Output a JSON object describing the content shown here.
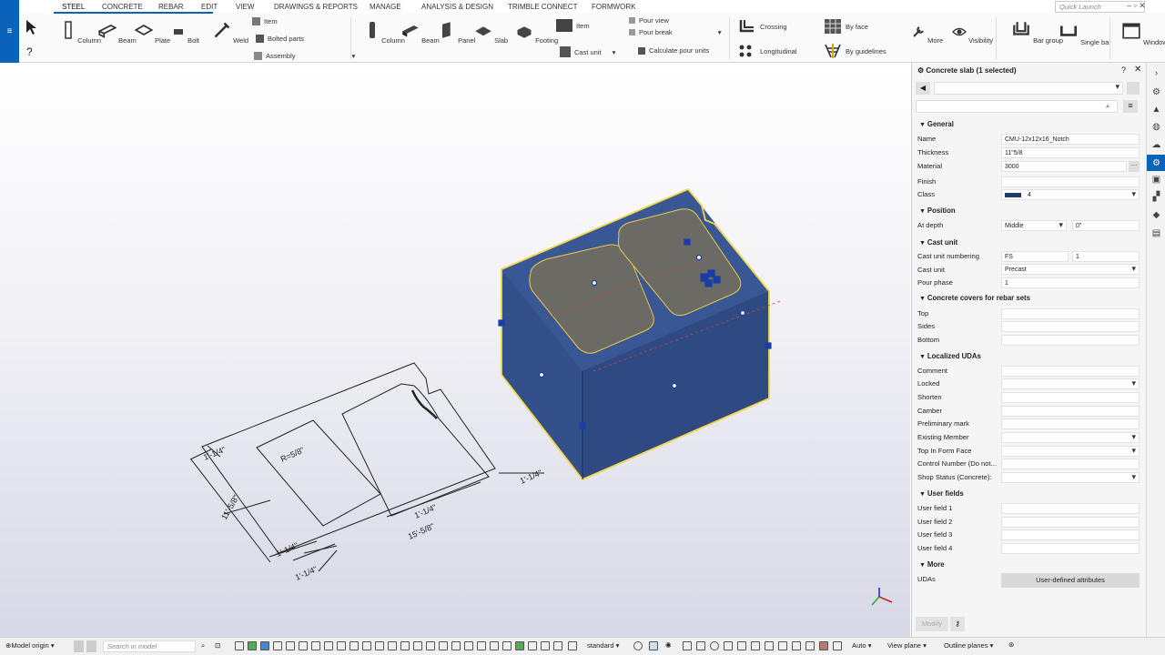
{
  "app": {
    "quick_launch_placeholder": "Quick Launch"
  },
  "menu_tabs": [
    "STEEL",
    "CONCRETE",
    "REBAR",
    "EDIT",
    "VIEW",
    "DRAWINGS & REPORTS",
    "MANAGE",
    "ANALYSIS & DESIGN",
    "TRIMBLE CONNECT",
    "FORMWORK"
  ],
  "ribbon": {
    "steel": {
      "column": "Column",
      "beam": "Beam",
      "plate": "Plate",
      "bolt": "Bolt",
      "weld": "Weld",
      "item": "Item",
      "bolted_parts": "Bolted parts",
      "assembly": "Assembly"
    },
    "concrete": {
      "column": "Column",
      "beam": "Beam",
      "panel": "Panel",
      "slab": "Slab",
      "footing": "Footing",
      "item": "Item",
      "cast_unit": "Cast unit",
      "pour_view": "Pour view",
      "pour_break": "Pour break",
      "calculate_pour_units": "Calculate pour units"
    },
    "rebar": {
      "crossing": "Crossing",
      "longitudinal": "Longitudinal",
      "by_face": "By face",
      "by_guidelines": "By guidelines",
      "more": "More",
      "visibility": "Visibility",
      "bar_group": "Bar group",
      "single_bar": "Single bar",
      "window": "Window"
    }
  },
  "drawing": {
    "dims": [
      "1'-1/4\"",
      "11'-5/8\"",
      "R=5/8\"",
      "1'-1/4\"",
      "1'-1/4\"",
      "1'-1/4\"",
      "15'-5/8\"",
      "1'-1/4\""
    ]
  },
  "panel": {
    "title": "Concrete slab (1 selected)",
    "sections": {
      "general": "General",
      "position": "Position",
      "cast_unit": "Cast unit",
      "covers": "Concrete covers for rebar sets",
      "udas": "Localized UDAs",
      "user_fields": "User fields",
      "more": "More"
    },
    "labels": {
      "name": "Name",
      "thickness": "Thickness",
      "material": "Material",
      "finish": "Finish",
      "class": "Class",
      "at_depth": "At depth",
      "cast_unit_numbering": "Cast unit numbering",
      "cast_unit": "Cast unit",
      "pour_phase": "Pour phase",
      "top": "Top",
      "sides": "Sides",
      "bottom": "Bottom",
      "comment": "Comment",
      "locked": "Locked",
      "shorten": "Shorten",
      "camber": "Camber",
      "preliminary_mark": "Preliminary mark",
      "existing_member": "Existing Member",
      "top_in_form_face": "Top In Form Face",
      "control_number": "Control Number (Do not...",
      "shop_status": "Shop Status (Concrete):",
      "uf1": "User field 1",
      "uf2": "User field 2",
      "uf3": "User field 3",
      "uf4": "User field 4",
      "udas": "UDAs"
    },
    "values": {
      "name": "CMU-12x12x16_Notch",
      "thickness": "11\"5/8",
      "material": "3000",
      "class": "4",
      "class_color": "#1f3a6b",
      "at_depth": "Middle",
      "at_depth_offset": "0\"",
      "cu_prefix": "FS",
      "cu_start": "1",
      "cast_unit": "Precast",
      "pour_phase": "1"
    },
    "buttons": {
      "uda": "User-defined attributes",
      "modify": "Modify"
    }
  },
  "statusbar": {
    "model_origin": "Model origin",
    "search_placeholder": "Search in model",
    "filter": "standard",
    "auto": "Auto",
    "view_plane": "View plane",
    "outline_planes": "Outline planes"
  },
  "colors": {
    "accent": "#0a63b8",
    "solid": "#35508b",
    "highlight": "#f2d64b"
  }
}
